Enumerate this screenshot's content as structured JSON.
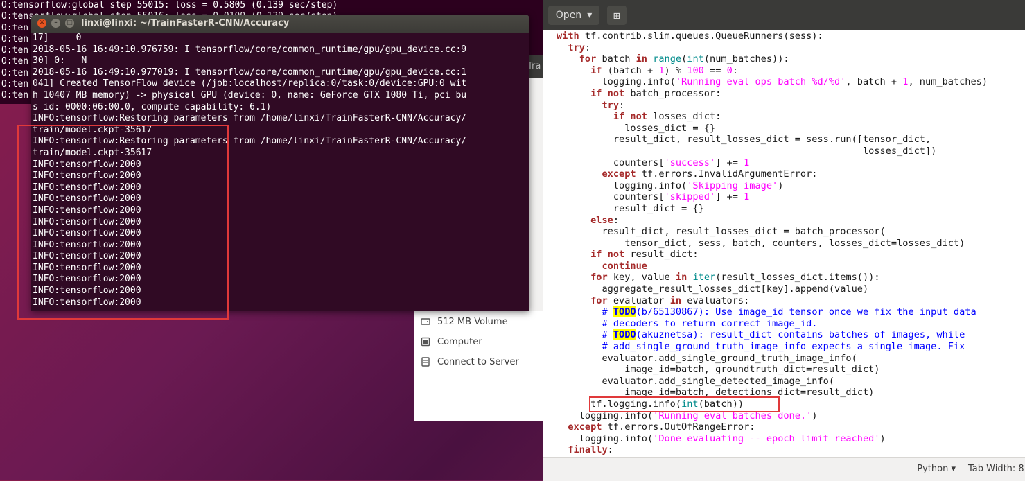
{
  "background_terminal": {
    "lines": [
      "O:tensorflow:global step 55015: loss = 0.5805 (0.139 sec/step)",
      "O:tensorflow:global step 55016: loss = 0.0109 (0.139 sec/step)",
      "O:ten",
      "O:ten",
      "O:ten",
      "O:ten",
      "O:ten",
      "O:ten",
      "O:ten"
    ]
  },
  "terminal": {
    "title": "linxi@linxi: ~/TrainFasterR-CNN/Accuracy",
    "close_glyph": "✕",
    "minimize_glyph": "–",
    "maximize_glyph": "□",
    "lines": [
      "17]     0",
      "2018-05-16 16:49:10.976759: I tensorflow/core/common_runtime/gpu/gpu_device.cc:9",
      "30] 0:   N",
      "2018-05-16 16:49:10.977019: I tensorflow/core/common_runtime/gpu/gpu_device.cc:1",
      "041] Created TensorFlow device (/job:localhost/replica:0/task:0/device:GPU:0 wit",
      "h 10407 MB memory) -> physical GPU (device: 0, name: GeForce GTX 1080 Ti, pci bu",
      "s id: 0000:06:00.0, compute capability: 6.1)",
      "INFO:tensorflow:Restoring parameters from /home/linxi/TrainFasterR-CNN/Accuracy/",
      "train/model.ckpt-35617",
      "INFO:tensorflow:Restoring parameters from /home/linxi/TrainFasterR-CNN/Accuracy/",
      "train/model.ckpt-35617",
      "INFO:tensorflow:2000",
      "INFO:tensorflow:2000",
      "INFO:tensorflow:2000",
      "INFO:tensorflow:2000",
      "INFO:tensorflow:2000",
      "INFO:tensorflow:2000",
      "INFO:tensorflow:2000",
      "INFO:tensorflow:2000",
      "INFO:tensorflow:2000",
      "INFO:tensorflow:2000",
      "INFO:tensorflow:2000",
      "INFO:tensorflow:2000",
      "INFO:tensorflow:2000"
    ]
  },
  "files_panel": {
    "strip_label": "Tra",
    "items": [
      {
        "label": "512 MB Volume",
        "icon": "drive-icon"
      },
      {
        "label": "Computer",
        "icon": "computer-icon"
      },
      {
        "label": "Connect to Server",
        "icon": "server-icon"
      }
    ]
  },
  "editor": {
    "open_label": "Open",
    "open_arrow": "▾",
    "new_tab_glyph": "⊞",
    "language": "Python",
    "language_arrow": "▾",
    "tab_width": "Tab Width: 8"
  },
  "colors": {
    "highlight_box": "#e0393a",
    "terminal_bg": "#300a24",
    "keyword": "#a52a2a",
    "string": "#ff00ff",
    "comment": "#0000ff",
    "builtin": "#008b8b"
  }
}
